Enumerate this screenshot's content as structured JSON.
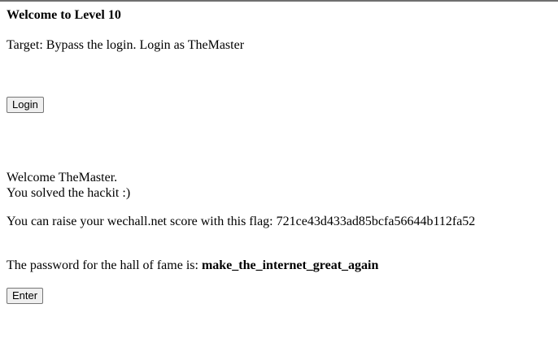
{
  "page": {
    "heading": "Welcome to Level 10",
    "target": "Target: Bypass the login. Login as TheMaster",
    "login_button": "Login",
    "welcome_line1": "Welcome TheMaster.",
    "welcome_line2": "You solved the hackit :)",
    "flag_text": "You can raise your wechall.net score with this flag: 721ce43d433ad85bcfa56644b112fa52",
    "password_prefix": "The password for the hall of fame is: ",
    "password_value": "make_the_internet_great_again",
    "enter_button": "Enter"
  }
}
